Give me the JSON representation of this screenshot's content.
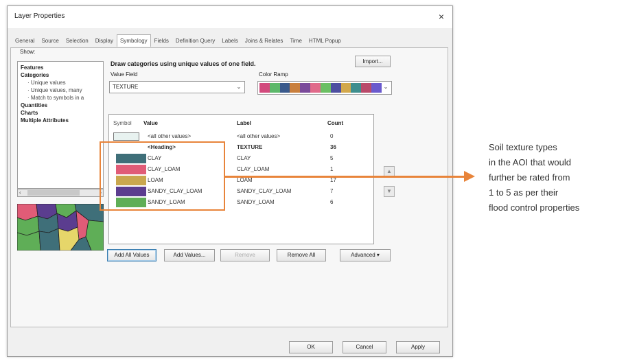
{
  "dialog": {
    "title": "Layer Properties",
    "close_label": "×",
    "tabs": [
      "General",
      "Source",
      "Selection",
      "Display",
      "Symbology",
      "Fields",
      "Definition Query",
      "Labels",
      "Joins & Relates",
      "Time",
      "HTML Popup"
    ],
    "active_tab": "Symbology"
  },
  "show_panel": {
    "label": "Show:",
    "items": [
      {
        "text": "Features",
        "level": 0
      },
      {
        "text": "Categories",
        "level": 0
      },
      {
        "text": "Unique values",
        "level": 1
      },
      {
        "text": "Unique values, many",
        "level": 1
      },
      {
        "text": "Match to symbols in a",
        "level": 1
      },
      {
        "text": "Quantities",
        "level": 0
      },
      {
        "text": "Charts",
        "level": 0
      },
      {
        "text": "Multiple Attributes",
        "level": 0
      }
    ]
  },
  "symbology": {
    "heading": "Draw categories using unique values of one field.",
    "import_label": "Import...",
    "value_field_label": "Value Field",
    "value_field_value": "TEXTURE",
    "color_ramp_label": "Color Ramp",
    "color_ramp_colors": [
      "#d24a7d",
      "#5cb86a",
      "#3a5a8c",
      "#c97f3d",
      "#7a4a9a",
      "#e06a8a",
      "#6bbf63",
      "#4d4fa0",
      "#d2a84c",
      "#3e8e8e",
      "#b94a6a",
      "#6a5acd"
    ],
    "columns": {
      "symbol": "Symbol",
      "value": "Value",
      "label": "Label",
      "count": "Count"
    },
    "rows": [
      {
        "value": "<all other values>",
        "label": "<all other values>",
        "count": "0",
        "color": "",
        "bold": false
      },
      {
        "value": "<Heading>",
        "label": "TEXTURE",
        "count": "36",
        "color": "",
        "bold": true
      },
      {
        "value": "CLAY",
        "label": "CLAY",
        "count": "5",
        "color": "#3f6f79",
        "bold": false
      },
      {
        "value": "CLAY_LOAM",
        "label": "CLAY_LOAM",
        "count": "1",
        "color": "#e05c77",
        "bold": false
      },
      {
        "value": "LOAM",
        "label": "LOAM",
        "count": "17",
        "color": "#c9a74f",
        "bold": false
      },
      {
        "value": "SANDY_CLAY_LOAM",
        "label": "SANDY_CLAY_LOAM",
        "count": "7",
        "color": "#5b3d8f",
        "bold": false
      },
      {
        "value": "SANDY_LOAM",
        "label": "SANDY_LOAM",
        "count": "6",
        "color": "#5fae57",
        "bold": false
      }
    ],
    "move_up_icon": "up-arrow-icon",
    "move_down_icon": "down-arrow-icon",
    "buttons": {
      "add_all_values": "Add All Values",
      "add_values": "Add Values...",
      "remove": "Remove",
      "remove_all": "Remove All",
      "advanced": "Advanced"
    }
  },
  "footer": {
    "ok": "OK",
    "cancel": "Cancel",
    "apply": "Apply"
  },
  "annotation": {
    "lines": [
      "Soil texture types",
      "in the AOI that would",
      "further be rated from",
      "1 to 5 as per their",
      "flood control properties"
    ],
    "color": "#e8843a"
  }
}
